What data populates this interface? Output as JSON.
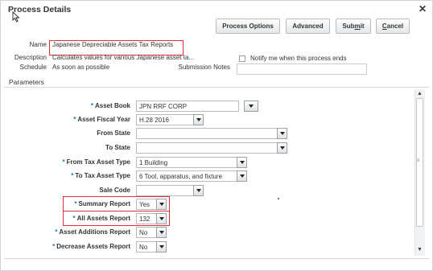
{
  "dialog": {
    "title": "Process Details",
    "close_glyph": "✕"
  },
  "toolbar": {
    "process_options_label": "Process Options",
    "advanced_label": "Advanced",
    "submit_label_a": "Sub",
    "submit_label_mnemonic": "m",
    "submit_label_b": "it",
    "cancel_label_a": "",
    "cancel_label_mnemonic": "C",
    "cancel_label_b": "ancel"
  },
  "details": {
    "name_label": "Name",
    "name_value": "Japanese Depreciable Assets Tax Reports",
    "description_label": "Description",
    "description_value": "Calculates values for various Japanese asset ta...",
    "schedule_label": "Schedule",
    "schedule_value": "As soon as possible",
    "submission_notes_label": "Submission Notes",
    "submission_notes_value": "",
    "notify_label": "Notify me when this process ends",
    "notify_checked": false
  },
  "parameters": {
    "section_title": "Parameters",
    "required_marker": "*",
    "fields": [
      {
        "label": "Asset Book",
        "required": true,
        "value": "JPN RRF CORP"
      },
      {
        "label": "Asset Fiscal Year",
        "required": true,
        "value": "H.28 2016"
      },
      {
        "label": "From State",
        "required": false,
        "value": ""
      },
      {
        "label": "To State",
        "required": false,
        "value": ""
      },
      {
        "label": "From Tax Asset Type",
        "required": true,
        "value": "1 Building"
      },
      {
        "label": "To Tax Asset Type",
        "required": true,
        "value": "6 Tool, apparatus, and fixture"
      },
      {
        "label": "Sale Code",
        "required": false,
        "value": ""
      },
      {
        "label": "Summary Report",
        "required": true,
        "value": "Yes"
      },
      {
        "label": "All Assets Report",
        "required": true,
        "value": "132"
      },
      {
        "label": "Asset Additions Report",
        "required": true,
        "value": "No"
      },
      {
        "label": "Decrease Assets Report",
        "required": true,
        "value": "No"
      }
    ]
  },
  "scrollbar": {
    "up_glyph": "▲",
    "down_glyph": "▼",
    "grip_glyph": "≡"
  },
  "colors": {
    "highlight_border": "#e0303a",
    "required_marker": "#1a73c8"
  }
}
